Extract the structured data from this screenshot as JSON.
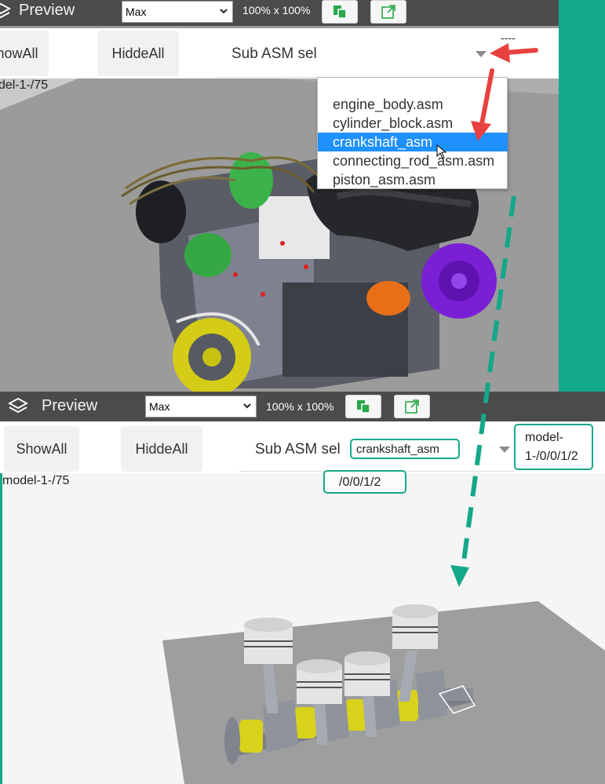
{
  "top_panel": {
    "title": "Preview",
    "size_select": {
      "value": "Max",
      "options": [
        "Max"
      ]
    },
    "zoom_text": "100% x 100%",
    "buttons": {
      "show_all": "ShowAll",
      "hide_all": "HiddeAll"
    },
    "subasm_label": "Sub ASM sel",
    "dashes": "----",
    "model_label": "del-1-/75",
    "dropdown_options": [
      {
        "label": "engine_body.asm",
        "selected": false
      },
      {
        "label": "cylinder_block.asm",
        "selected": false
      },
      {
        "label": "crankshaft_asm",
        "selected": true
      },
      {
        "label": "connecting_rod_asm.asm",
        "selected": false
      },
      {
        "label": "piston_asm.asm",
        "selected": false
      }
    ]
  },
  "bottom_panel": {
    "title": "Preview",
    "size_select": {
      "value": "Max",
      "options": [
        "Max"
      ]
    },
    "zoom_text": "100% x 100%",
    "buttons": {
      "show_all": "ShowAll",
      "hide_all": "HiddeAll"
    },
    "subasm_label": "Sub ASM sel",
    "subasm_value": "crankshaft_asm",
    "path_label": "/0/0/1/2",
    "model_label": "model-1-/75",
    "model_path_line1": "model-",
    "model_path_line2": "1-/0/0/1/2"
  },
  "colors": {
    "teal": "#13a889",
    "annotation_red": "#e8413f",
    "titlebar": "#4b4b4b",
    "selection_blue": "#1e90ff",
    "copy_icon_green": "#2aa84a"
  },
  "icons": [
    "layers-icon",
    "copy-icon",
    "open-external-icon",
    "chevron-down-icon",
    "dropdown-triangle-icon",
    "mouse-cursor-icon"
  ]
}
